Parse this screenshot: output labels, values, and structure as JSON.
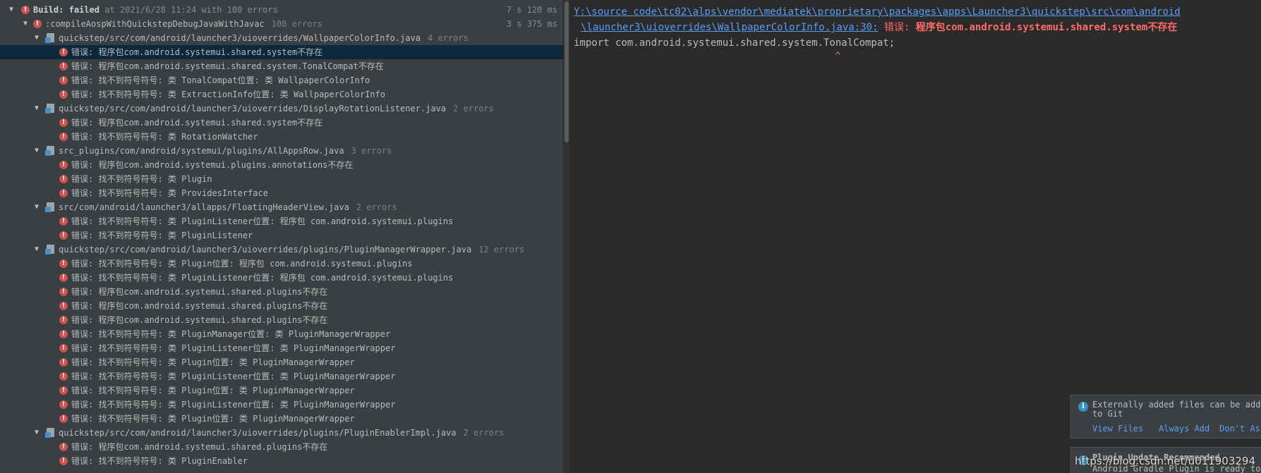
{
  "build": {
    "header_label": "Build:",
    "status": "failed",
    "meta": "at 2021/6/28 11:24 with 100 errors",
    "time": "7 s 120 ms",
    "task": ":compileAospWithQuickstepDebugJavaWithJavac",
    "task_count": "100 errors",
    "task_time": "3 s 375 ms"
  },
  "tree": [
    {
      "kind": "file",
      "path": "quickstep/src/com/android/launcher3/uioverrides/WallpaperColorInfo.java",
      "count": "4 errors"
    },
    {
      "kind": "err",
      "text": "错误: 程序包com.android.systemui.shared.system不存在",
      "selected": true
    },
    {
      "kind": "err",
      "text": "错误: 程序包com.android.systemui.shared.system.TonalCompat不存在"
    },
    {
      "kind": "err",
      "text": "错误: 找不到符号符号:   类 TonalCompat位置: 类 WallpaperColorInfo"
    },
    {
      "kind": "err",
      "text": "错误: 找不到符号符号:   类 ExtractionInfo位置: 类 WallpaperColorInfo"
    },
    {
      "kind": "file",
      "path": "quickstep/src/com/android/launcher3/uioverrides/DisplayRotationListener.java",
      "count": "2 errors"
    },
    {
      "kind": "err",
      "text": "错误: 程序包com.android.systemui.shared.system不存在"
    },
    {
      "kind": "err",
      "text": "错误: 找不到符号符号: 类 RotationWatcher"
    },
    {
      "kind": "file",
      "path": "src_plugins/com/android/systemui/plugins/AllAppsRow.java",
      "count": "3 errors"
    },
    {
      "kind": "err",
      "text": "错误: 程序包com.android.systemui.plugins.annotations不存在"
    },
    {
      "kind": "err",
      "text": "错误: 找不到符号符号: 类 Plugin"
    },
    {
      "kind": "err",
      "text": "错误: 找不到符号符号: 类 ProvidesInterface"
    },
    {
      "kind": "file",
      "path": "src/com/android/launcher3/allapps/FloatingHeaderView.java",
      "count": "2 errors"
    },
    {
      "kind": "err",
      "text": "错误: 找不到符号符号:   类 PluginListener位置: 程序包 com.android.systemui.plugins"
    },
    {
      "kind": "err",
      "text": "错误: 找不到符号符号: 类 PluginListener"
    },
    {
      "kind": "file",
      "path": "quickstep/src/com/android/launcher3/uioverrides/plugins/PluginManagerWrapper.java",
      "count": "12 errors"
    },
    {
      "kind": "err",
      "text": "错误: 找不到符号符号:   类 Plugin位置: 程序包 com.android.systemui.plugins"
    },
    {
      "kind": "err",
      "text": "错误: 找不到符号符号:   类 PluginListener位置: 程序包 com.android.systemui.plugins"
    },
    {
      "kind": "err",
      "text": "错误: 程序包com.android.systemui.shared.plugins不存在"
    },
    {
      "kind": "err",
      "text": "错误: 程序包com.android.systemui.shared.plugins不存在"
    },
    {
      "kind": "err",
      "text": "错误: 程序包com.android.systemui.shared.plugins不存在"
    },
    {
      "kind": "err",
      "text": "错误: 找不到符号符号:   类 PluginManager位置: 类 PluginManagerWrapper"
    },
    {
      "kind": "err",
      "text": "错误: 找不到符号符号:   类 PluginListener位置: 类 PluginManagerWrapper"
    },
    {
      "kind": "err",
      "text": "错误: 找不到符号符号:   类 Plugin位置: 类 PluginManagerWrapper"
    },
    {
      "kind": "err",
      "text": "错误: 找不到符号符号:   类 PluginListener位置: 类 PluginManagerWrapper"
    },
    {
      "kind": "err",
      "text": "错误: 找不到符号符号:   类 Plugin位置: 类 PluginManagerWrapper"
    },
    {
      "kind": "err",
      "text": "错误: 找不到符号符号:   类 PluginListener位置: 类 PluginManagerWrapper"
    },
    {
      "kind": "err",
      "text": "错误: 找不到符号符号:   类 Plugin位置: 类 PluginManagerWrapper"
    },
    {
      "kind": "file",
      "path": "quickstep/src/com/android/launcher3/uioverrides/plugins/PluginEnablerImpl.java",
      "count": "2 errors"
    },
    {
      "kind": "err",
      "text": "错误: 程序包com.android.systemui.shared.plugins不存在"
    },
    {
      "kind": "err",
      "text": "错误: 找不到符号符号: 类 PluginEnabler"
    }
  ],
  "detail": {
    "path_line1": "Y:\\source code\\tc02\\alps\\vendor\\mediatek\\proprietary\\packages\\apps\\Launcher3\\quickstep\\src\\com\\android",
    "path_line2": "\\launcher3\\uioverrides\\WallpaperColorInfo.java:30:",
    "err_label": "错误:",
    "err_msg": "程序包com.android.systemui.shared.system不存在",
    "code": "import com.android.systemui.shared.system.TonalCompat;",
    "caret": "^"
  },
  "notifications": {
    "vcs_text_line1": "Externally added files can be added",
    "vcs_text_line2": "to Git",
    "vcs_action_view": "View Files",
    "vcs_action_always": "Always Add",
    "vcs_action_dont": "Don't Ask",
    "gradle_title": "Plugin Update Recommended",
    "gradle_text": "Android Gradle Plugin is ready to u"
  },
  "watermark": "https://blog.csdn.net/u011903294"
}
